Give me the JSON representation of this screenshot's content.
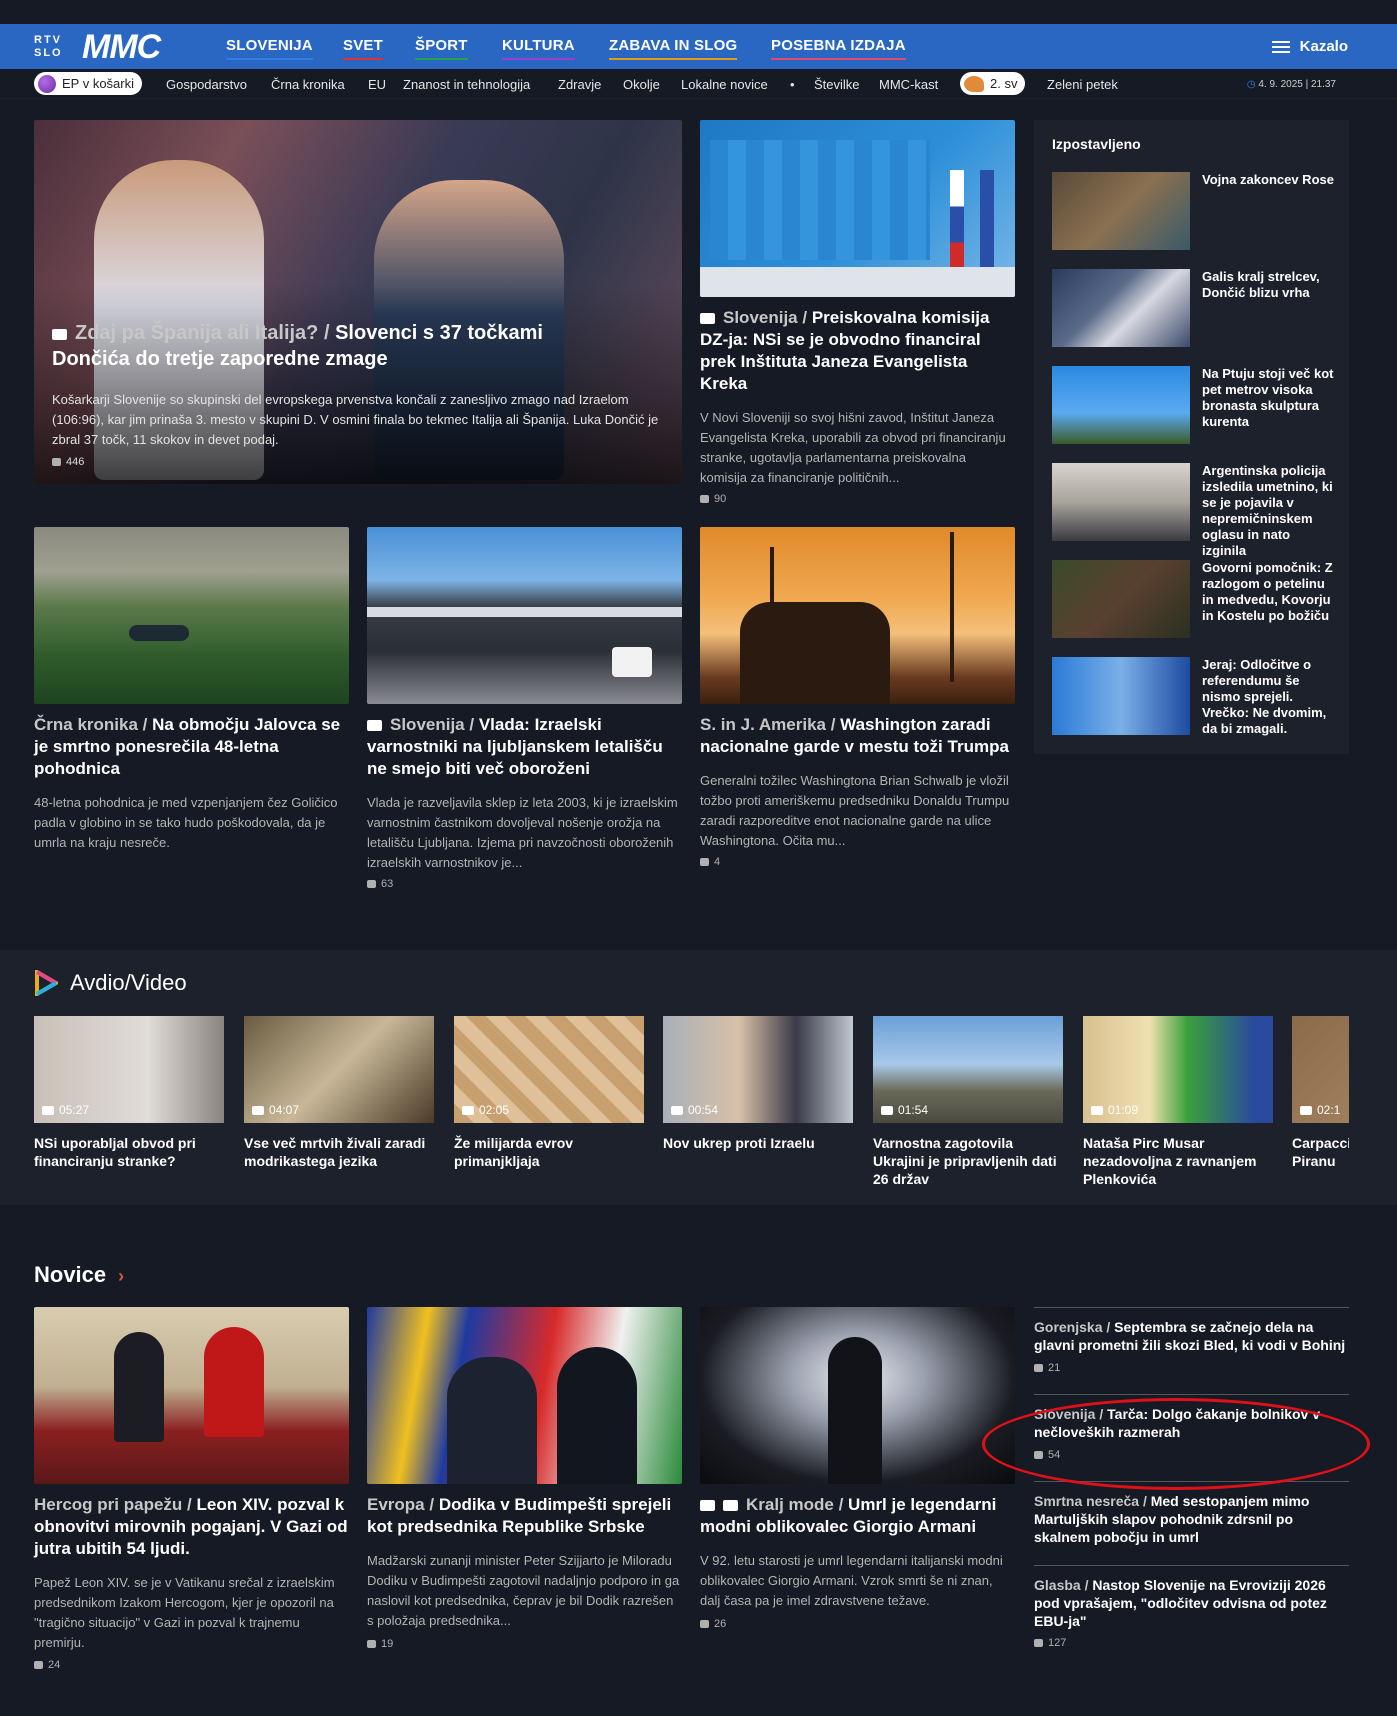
{
  "header": {
    "logo_small": "RTV SLO",
    "logo_big": "MMC",
    "nav": [
      "SLOVENIJA",
      "SVET",
      "ŠPORT",
      "KULTURA",
      "ZABAVA IN SLOG",
      "POSEBNA IZDAJA"
    ],
    "menu_label": "Kazalo"
  },
  "subnav": {
    "pill1": "EP v košarki",
    "items": [
      "Gospodarstvo",
      "Črna kronika",
      "EU",
      "Znanost in tehnologija",
      "Zdravje",
      "Okolje",
      "Lokalne novice",
      "•",
      "Številke",
      "MMC-kast"
    ],
    "pill2": "2. sv",
    "item_after": "Zeleni petek",
    "datetime": "4. 9. 2025 | 21.37"
  },
  "featured": {
    "main": {
      "cat": "Zdaj pa Španija ali Italija? /",
      "title": "Slovenci s 37 točkami Dončića do tretje zaporedne zmage",
      "lead": "Košarkarji Slovenije so skupinski del evropskega prvenstva končali z zanesljivo zmago nad Izraelom (106:96), kar jim prinaša 3. mesto v skupini D. V osmini finala bo tekmec Italija ali Španija. Luka Dončić je zbral 37 točk, 11 skokov in devet podaj.",
      "comments": "446"
    },
    "second": {
      "cat": "Slovenija /",
      "title": "Preiskovalna komisija DZ-ja: NSi se je obvodno financiral prek Inštituta Janeza Evangelista Kreka",
      "lead": "V Novi Sloveniji so svoj hišni zavod, Inštitut Janeza Evangelista Kreka, uporabili za obvod pri financiranju stranke, ugotavlja parlamentarna preiskovalna komisija za financiranje političnih...",
      "comments": "90"
    },
    "row2": [
      {
        "cat": "Črna kronika /",
        "title": "Na območju Jalovca se je smrtno ponesrečila 48-letna pohodnica",
        "lead": "48-letna pohodnica je med vzpenjanjem čez Goličico padla v globino in se tako hudo poškodovala, da je umrla na kraju nesreče.",
        "comments": ""
      },
      {
        "cat": "Slovenija /",
        "title": "Vlada: Izraelski varnostniki na ljubljanskem letališču ne smejo biti več oboroženi",
        "lead": "Vlada je razveljavila sklep iz leta 2003, ki je izraelskim varnostnim častnikom dovoljeval nošenje orožja na letališču Ljubljana. Izjema pri navzočnosti oboroženih izraelskih varnostnikov je...",
        "comments": "63"
      },
      {
        "cat": "S. in J. Amerika /",
        "title": "Washington zaradi nacionalne garde v mestu toži Trumpa",
        "lead": "Generalni tožilec Washingtona Brian Schwalb je vložil tožbo proti ameriškemu predsedniku Donaldu Trumpu zaradi razporeditve enot nacionalne garde na ulice Washingtona. Očita mu...",
        "comments": "4"
      }
    ]
  },
  "izpostavljeno": {
    "title": "Izpostavljeno",
    "items": [
      "Vojna zakoncev Rose",
      "Galis kralj strelcev, Dončić blizu vrha",
      "Na Ptuju stoji več kot pet metrov visoka bronasta skulptura kurenta",
      "Argentinska policija izsledila umetnino, ki se je pojavila v nepremičninskem oglasu in nato izginila",
      "Govorni pomočnik: Z razlogom o petelinu in medvedu, Kovorju in Kostelu po božiču",
      "Jeraj: Odločitve o referendumu še nismo sprejeli. Vrečko: Ne dvomim, da bi zmagali."
    ]
  },
  "avdio": {
    "title": "Avdio/Video",
    "items": [
      {
        "dur": "05:27",
        "title": "NSi uporabljal obvod pri financiranju stranke?"
      },
      {
        "dur": "04:07",
        "title": "Vse več mrtvih živali zaradi modrikastega jezika"
      },
      {
        "dur": "02:05",
        "title": "Že milijarda evrov primanjkljaja"
      },
      {
        "dur": "00:54",
        "title": "Nov ukrep proti Izraelu"
      },
      {
        "dur": "01:54",
        "title": "Varnostna zagotovila Ukrajini je pripravljenih dati 26 držav"
      },
      {
        "dur": "01:09",
        "title": "Nataša Pirc Musar nezadovoljna z ravnanjem Plenkovića"
      },
      {
        "dur": "02:1",
        "title": "Carpacci Piranu"
      }
    ]
  },
  "novice": {
    "title": "Novice",
    "articles": [
      {
        "cat": "Hercog pri papežu /",
        "title": "Leon XIV. pozval k obnovitvi mirovnih pogajanj. V Gazi od jutra ubitih 54 ljudi.",
        "lead": "Papež Leon XIV. se je v Vatikanu srečal z izraelskim predsednikom Izakom Hercogom, kjer je opozoril na \"tragično situacijo\" v Gazi in pozval k trajnemu premirju.",
        "comments": "24"
      },
      {
        "cat": "Evropa /",
        "title": "Dodika v Budimpešti sprejeli kot predsednika Republike Srbske",
        "lead": "Madžarski zunanji minister Peter Szijjarto je Miloradu Dodiku v Budimpešti zagotovil nadaljnjo podporo in ga naslovil kot predsednika, čeprav je bil Dodik razrešen s položaja predsednika...",
        "comments": "19"
      },
      {
        "cat": "Kralj mode /",
        "title": "Umrl je legendarni modni oblikovalec Giorgio Armani",
        "lead": "V 92. letu starosti je umrl legendarni italijanski modni oblikovalec Giorgio Armani. Vzrok smrti še ni znan, dalj časa pa je imel zdravstvene težave.",
        "comments": "26"
      }
    ],
    "list": [
      {
        "cat": "Gorenjska /",
        "title": "Septembra se začnejo dela na glavni prometni žili skozi Bled, ki vodi v Bohinj",
        "comments": "21"
      },
      {
        "cat": "Slovenija /",
        "title": "Tarča: Dolgo čakanje bolnikov v nečloveških razmerah",
        "comments": "54"
      },
      {
        "cat": "Smrtna nesreča /",
        "title": "Med sestopanjem mimo Martuljških slapov pohodnik zdrsnil po skalnem pobočju in umrl",
        "comments": ""
      },
      {
        "cat": "Glasba /",
        "title": "Nastop Slovenije na Evroviziji 2026 pod vprašajem, \"odločitev odvisna od potez EBU-ja\"",
        "comments": "127"
      }
    ]
  },
  "colors": {
    "nav": "#2a67c2",
    "bg": "#151a24",
    "panel": "#1c212b",
    "highlight_ring": "#e0101a"
  }
}
